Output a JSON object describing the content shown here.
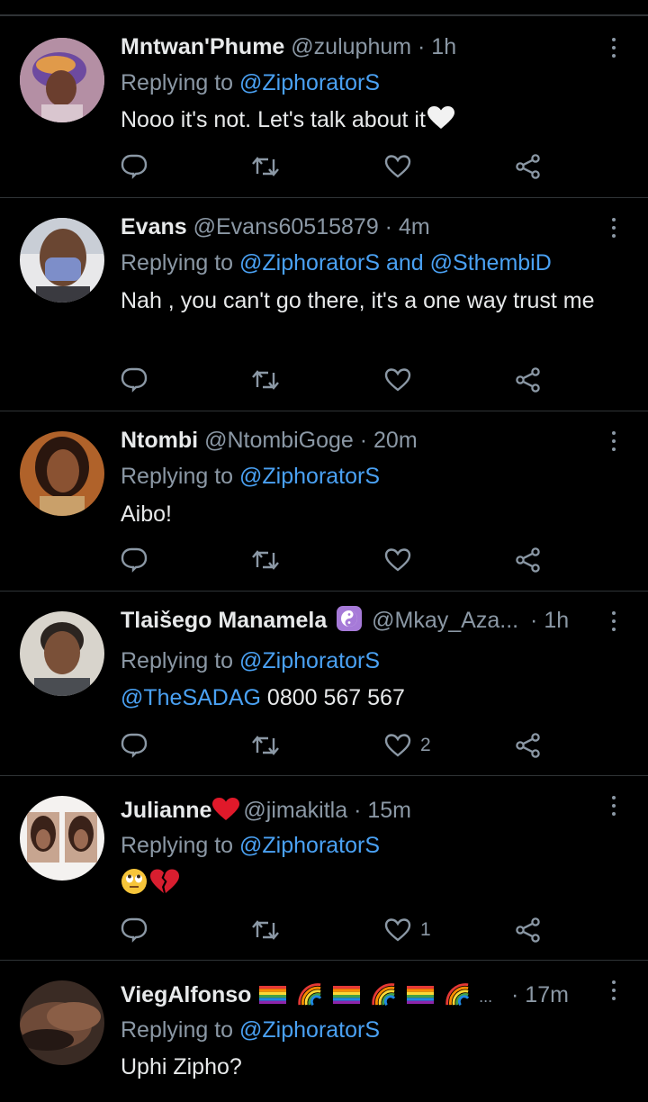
{
  "tweets": [
    {
      "name": "Mntwan'Phume",
      "handle": "@zuluphum",
      "time": "· 1h",
      "reply_prefix": "Replying to",
      "reply_to": "@ZiphoratorS",
      "reply_joiner": "",
      "reply_to2": "",
      "body": "Nooo it's not. Let's talk about it",
      "likes": ""
    },
    {
      "name": "Evans",
      "handle": "@Evans60515879",
      "time": "· 4m",
      "reply_prefix": "Replying to",
      "reply_to": "@ZiphoratorS",
      "reply_joiner": " and ",
      "reply_to2": "@SthembiD",
      "body": "Nah , you can't go there,  it's a one way trust me",
      "likes": ""
    },
    {
      "name": "Ntombi",
      "handle": "@NtombiGoge",
      "time": "· 20m",
      "reply_prefix": "Replying to",
      "reply_to": "@ZiphoratorS",
      "reply_joiner": "",
      "reply_to2": "",
      "body": "Aibo!",
      "likes": ""
    },
    {
      "name": "Tlaišego Manamela",
      "handle": "@Mkay_Aza...",
      "time": "· 1h",
      "reply_prefix": "Replying to",
      "reply_to": "@ZiphoratorS",
      "reply_joiner": "",
      "reply_to2": "",
      "body_link": "@TheSADAG",
      "body": " 0800 567 567",
      "likes": "2"
    },
    {
      "name": "Julianne",
      "handle": "@jimakitla",
      "time": "· 15m",
      "reply_prefix": "Replying to",
      "reply_to": "@ZiphoratorS",
      "reply_joiner": "",
      "reply_to2": "",
      "body": "",
      "likes": "1"
    },
    {
      "name": "ViegAlfonso",
      "handle": "...",
      "time": "· 17m",
      "reply_prefix": "Replying to",
      "reply_to": "@ZiphoratorS",
      "reply_joiner": "",
      "reply_to2": "",
      "body": "Uphi Zipho?",
      "likes": ""
    }
  ],
  "icons": {
    "reply": "comment-icon",
    "retweet": "retweet-icon",
    "like": "heart-icon",
    "share": "share-icon",
    "more": "more-options-icon"
  },
  "colors": {
    "background": "#000000",
    "link": "#4aa1f3",
    "muted": "#8b98a5",
    "text": "#e7e9ea",
    "divider": "#2f3336"
  }
}
